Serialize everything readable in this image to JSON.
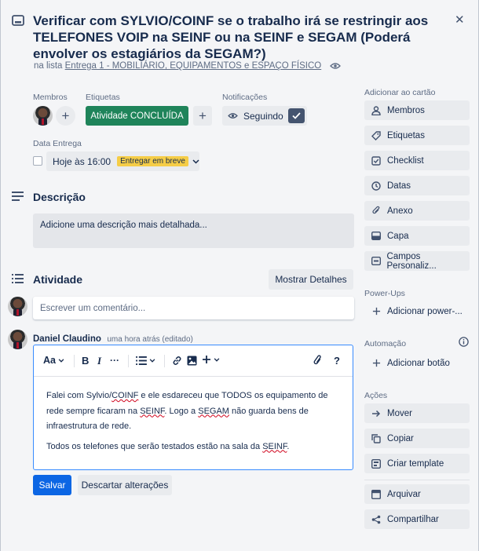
{
  "header": {
    "title": "Verificar com SYLVIO/COINF se o trabalho irá se restringir aos TELEFONES VOIP na SEINF ou na SEINF e SEGAM (Poderá envolver os estagiários da SEGAM?)",
    "list_prefix": "na lista",
    "list_name": "Entrega 1 - MOBILIÁRIO, EQUIPAMENTOS e ESPAÇO FÍSICO",
    "close_symbol": "✕"
  },
  "members": {
    "label": "Membros",
    "add_symbol": "+"
  },
  "labels": {
    "label": "Etiquetas",
    "chip": "Atividade CONCLUÍDA",
    "chip_color": "#1f845a",
    "add_symbol": "+"
  },
  "notifications": {
    "label": "Notificações",
    "watch_label": "Seguindo"
  },
  "due": {
    "label": "Data Entrega",
    "value": "Hoje às 16:00",
    "badge": "Entregar em breve",
    "badge_color": "#f5cd47"
  },
  "description": {
    "title": "Descrição",
    "placeholder": "Adicione uma descrição mais detalhada..."
  },
  "activity": {
    "title": "Atividade",
    "show_details": "Mostrar Detalhes",
    "comment_placeholder": "Escrever um comentário...",
    "author": "Daniel Claudino",
    "time": "uma hora atrás (editado)"
  },
  "editor": {
    "toolbar": {
      "text_style": "Aa",
      "bold": "B",
      "italic": "I",
      "more": "···",
      "help": "?"
    },
    "p1_a": "Falei com Sylvio/",
    "p1_coinf": "COINF",
    "p1_b": " e ele esdareceu que TODOS os equipamento de rede sempre ficaram na ",
    "p1_seinf": "SEINF",
    "p1_c": ". Logo a ",
    "p1_segam": "SEGAM",
    "p1_d": " não guarda bens de infraestrutura de rede.",
    "p2_a": "Todos os telefones que serão testados estão na sala da ",
    "p2_seinf": "SEINF",
    "p2_b": ".",
    "save": "Salvar",
    "discard": "Descartar alterações"
  },
  "sidebar": {
    "add_to_card": "Adicionar ao cartão",
    "items": [
      "Membros",
      "Etiquetas",
      "Checklist",
      "Datas",
      "Anexo",
      "Capa",
      "Campos Personaliz..."
    ],
    "powerups_title": "Power-Ups",
    "powerups_add": "Adicionar power-...",
    "automation_title": "Automação",
    "automation_add": "Adicionar botão",
    "actions_title": "Ações",
    "actions": [
      "Mover",
      "Copiar",
      "Criar template"
    ],
    "archive": "Arquivar",
    "share": "Compartilhar"
  },
  "colors": {
    "primary": "#0c66e4",
    "editor_border": "#388bff"
  }
}
